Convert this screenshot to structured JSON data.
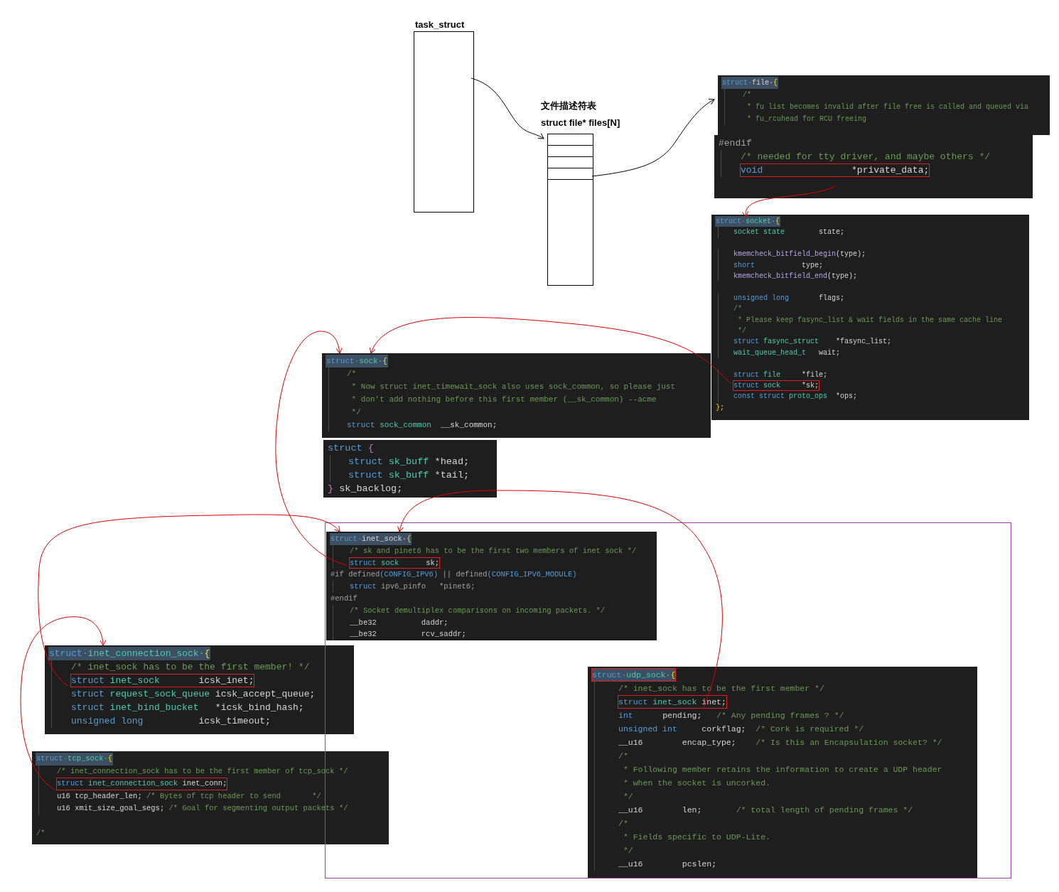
{
  "task_struct": {
    "title": "task_struct"
  },
  "fd_table": {
    "title": "文件描述符表",
    "subtitle": "struct file* files[N]"
  },
  "panels": [
    {
      "lines": [
        {
          "kind": "header",
          "indented": false,
          "boxed": false,
          "parts": [
            {
              "text": "struct·",
              "kind": "kw"
            },
            {
              "text": "file·",
              "kind": "id"
            },
            {
              "text": "{",
              "kind": "brace"
            }
          ]
        },
        {
          "kind": "code",
          "indented": true,
          "boxed": false,
          "parts": [
            {
              "text": "/*",
              "kind": "comment"
            }
          ]
        },
        {
          "kind": "code",
          "indented": true,
          "boxed": false,
          "parts": [
            {
              "text": " * fu list becomes invalid after file free is called and queued via",
              "kind": "comment"
            }
          ]
        },
        {
          "kind": "code",
          "indented": true,
          "boxed": false,
          "parts": [
            {
              "text": " * fu_rcuhead for RCU freeing",
              "kind": "comment"
            }
          ]
        }
      ]
    },
    {
      "lines": [
        {
          "kind": "code",
          "indented": false,
          "boxed": false,
          "parts": [
            {
              "text": "#endif",
              "kind": "preproc"
            }
          ]
        },
        {
          "kind": "code",
          "indented": true,
          "boxed": false,
          "parts": [
            {
              "text": "/* needed for tty driver, and maybe others */",
              "kind": "comment"
            }
          ]
        },
        {
          "kind": "code",
          "indented": true,
          "boxed": true,
          "parts": [
            {
              "text": "void",
              "kind": "kw"
            },
            {
              "text": "                *private_data;",
              "kind": "id"
            }
          ]
        }
      ]
    },
    {
      "lines": [
        {
          "kind": "header",
          "indented": false,
          "boxed": false,
          "parts": [
            {
              "text": "struct·",
              "kind": "kw"
            },
            {
              "text": "socket·",
              "kind": "type"
            },
            {
              "text": "{",
              "kind": "brace"
            }
          ]
        },
        {
          "kind": "code",
          "indented": true,
          "boxed": false,
          "parts": [
            {
              "text": "socket state",
              "kind": "type"
            },
            {
              "text": "        state;",
              "kind": "id"
            }
          ]
        },
        {
          "kind": "blank"
        },
        {
          "kind": "code",
          "indented": true,
          "boxed": false,
          "parts": [
            {
              "text": "kmemcheck_bitfield_begin",
              "kind": "fn"
            },
            {
              "text": "(type);",
              "kind": "id"
            }
          ]
        },
        {
          "kind": "code",
          "indented": true,
          "boxed": false,
          "parts": [
            {
              "text": "short",
              "kind": "kw"
            },
            {
              "text": "           type;",
              "kind": "id"
            }
          ]
        },
        {
          "kind": "code",
          "indented": true,
          "boxed": false,
          "parts": [
            {
              "text": "kmemcheck_bitfield_end",
              "kind": "fn"
            },
            {
              "text": "(type);",
              "kind": "id"
            }
          ]
        },
        {
          "kind": "blank"
        },
        {
          "kind": "code",
          "indented": true,
          "boxed": false,
          "parts": [
            {
              "text": "unsigned long",
              "kind": "kw"
            },
            {
              "text": "       flags;",
              "kind": "id"
            }
          ]
        },
        {
          "kind": "code",
          "indented": true,
          "boxed": false,
          "parts": [
            {
              "text": "/*",
              "kind": "comment"
            }
          ]
        },
        {
          "kind": "code",
          "indented": true,
          "boxed": false,
          "parts": [
            {
              "text": " * Please keep fasync_list & wait fields in the same cache line",
              "kind": "comment"
            }
          ]
        },
        {
          "kind": "code",
          "indented": true,
          "boxed": false,
          "parts": [
            {
              "text": " */",
              "kind": "comment"
            }
          ]
        },
        {
          "kind": "code",
          "indented": true,
          "boxed": false,
          "parts": [
            {
              "text": "struct ",
              "kind": "kw"
            },
            {
              "text": "fasync_struct",
              "kind": "type"
            },
            {
              "text": "    *fasync_list;",
              "kind": "id"
            }
          ]
        },
        {
          "kind": "code",
          "indented": true,
          "boxed": false,
          "parts": [
            {
              "text": "wait_queue_head_t",
              "kind": "type"
            },
            {
              "text": "   wait;",
              "kind": "id"
            }
          ]
        },
        {
          "kind": "blank"
        },
        {
          "kind": "code",
          "indented": true,
          "boxed": false,
          "parts": [
            {
              "text": "struct ",
              "kind": "kw"
            },
            {
              "text": "file",
              "kind": "type"
            },
            {
              "text": "     *file;",
              "kind": "id"
            }
          ]
        },
        {
          "kind": "code",
          "indented": true,
          "boxed": true,
          "parts": [
            {
              "text": "struct ",
              "kind": "kw"
            },
            {
              "text": "sock",
              "kind": "type"
            },
            {
              "text": "     *sk;",
              "kind": "id"
            }
          ]
        },
        {
          "kind": "code",
          "indented": true,
          "boxed": false,
          "parts": [
            {
              "text": "const struct ",
              "kind": "kw"
            },
            {
              "text": "proto_ops",
              "kind": "type"
            },
            {
              "text": "  *ops;",
              "kind": "id"
            }
          ]
        },
        {
          "kind": "code",
          "indented": false,
          "boxed": false,
          "parts": [
            {
              "text": "};",
              "kind": "brace"
            }
          ]
        }
      ]
    },
    {
      "lines": [
        {
          "kind": "header",
          "indented": false,
          "boxed": false,
          "parts": [
            {
              "text": "struct·",
              "kind": "kw"
            },
            {
              "text": "sock·",
              "kind": "type"
            },
            {
              "text": "{",
              "kind": "brace"
            }
          ]
        },
        {
          "kind": "code",
          "indented": true,
          "boxed": false,
          "parts": [
            {
              "text": "/*",
              "kind": "comment"
            }
          ]
        },
        {
          "kind": "code",
          "indented": true,
          "boxed": false,
          "parts": [
            {
              "text": " * Now struct inet_timewait_sock also uses sock_common, so please just",
              "kind": "comment"
            }
          ]
        },
        {
          "kind": "code",
          "indented": true,
          "boxed": false,
          "parts": [
            {
              "text": " * don't add nothing before this first member (__sk_common) --acme",
              "kind": "comment"
            }
          ]
        },
        {
          "kind": "code",
          "indented": true,
          "boxed": false,
          "parts": [
            {
              "text": " */",
              "kind": "comment"
            }
          ]
        },
        {
          "kind": "code",
          "indented": true,
          "boxed": false,
          "parts": [
            {
              "text": "struct ",
              "kind": "kw"
            },
            {
              "text": "sock_common",
              "kind": "type"
            },
            {
              "text": "  __sk_common;",
              "kind": "id"
            }
          ]
        }
      ]
    },
    {
      "lines": [
        {
          "kind": "code",
          "indented": false,
          "boxed": false,
          "parts": [
            {
              "text": "struct ",
              "kind": "kw"
            },
            {
              "text": "{",
              "kind": "macro"
            }
          ]
        },
        {
          "kind": "code",
          "indented": true,
          "boxed": false,
          "parts": [
            {
              "text": "struct ",
              "kind": "kw"
            },
            {
              "text": "sk_buff ",
              "kind": "type"
            },
            {
              "text": "*head;",
              "kind": "id"
            }
          ]
        },
        {
          "kind": "code",
          "indented": true,
          "boxed": false,
          "parts": [
            {
              "text": "struct ",
              "kind": "kw"
            },
            {
              "text": "sk_buff ",
              "kind": "type"
            },
            {
              "text": "*tail;",
              "kind": "id"
            }
          ]
        },
        {
          "kind": "code",
          "indented": false,
          "boxed": false,
          "parts": [
            {
              "text": "}",
              "kind": "macro"
            },
            {
              "text": " sk_backlog;",
              "kind": "id"
            }
          ]
        }
      ]
    },
    {
      "lines": [
        {
          "kind": "header",
          "indented": false,
          "boxed": false,
          "parts": [
            {
              "text": "struct·",
              "kind": "kw"
            },
            {
              "text": "inet_sock·",
              "kind": "id"
            },
            {
              "text": "{",
              "kind": "brace"
            }
          ]
        },
        {
          "kind": "code",
          "indented": true,
          "boxed": false,
          "parts": [
            {
              "text": "/* sk and pinet6 has to be the first two members of inet sock */",
              "kind": "comment"
            }
          ]
        },
        {
          "kind": "code",
          "indented": true,
          "boxed": true,
          "parts": [
            {
              "text": "struct ",
              "kind": "kw"
            },
            {
              "text": "sock",
              "kind": "type"
            },
            {
              "text": "      sk;",
              "kind": "id"
            }
          ]
        },
        {
          "kind": "code",
          "indented": false,
          "boxed": false,
          "parts": [
            {
              "text": "#if defined",
              "kind": "preproc"
            },
            {
              "text": "(CONFIG_IPV6)",
              "kind": "kw"
            },
            {
              "text": " || defined",
              "kind": "preproc"
            },
            {
              "text": "(CONFIG_IPV6_MODULE)",
              "kind": "kw"
            }
          ]
        },
        {
          "kind": "code",
          "indented": true,
          "boxed": false,
          "parts": [
            {
              "text": "struct ",
              "kind": "kw"
            },
            {
              "text": "ipv6_pinfo   *pinet6;",
              "kind": "preproc"
            }
          ]
        },
        {
          "kind": "code",
          "indented": false,
          "boxed": false,
          "parts": [
            {
              "text": "#endif",
              "kind": "preproc"
            }
          ]
        },
        {
          "kind": "code",
          "indented": true,
          "boxed": false,
          "parts": [
            {
              "text": "/* Socket demultiplex comparisons on incoming packets. */",
              "kind": "comment"
            }
          ]
        },
        {
          "kind": "code",
          "indented": true,
          "boxed": false,
          "parts": [
            {
              "text": "__be32",
              "kind": "id"
            },
            {
              "text": "          daddr;",
              "kind": "id"
            }
          ]
        },
        {
          "kind": "code",
          "indented": true,
          "boxed": false,
          "parts": [
            {
              "text": "__be32",
              "kind": "id"
            },
            {
              "text": "          rcv_saddr;",
              "kind": "id"
            }
          ]
        }
      ]
    },
    {
      "lines": [
        {
          "kind": "header",
          "indented": false,
          "boxed": false,
          "parts": [
            {
              "text": "struct·",
              "kind": "kw"
            },
            {
              "text": "inet_connection_sock·",
              "kind": "type"
            },
            {
              "text": "{",
              "kind": "brace"
            }
          ]
        },
        {
          "kind": "code",
          "indented": true,
          "boxed": false,
          "parts": [
            {
              "text": "/* inet_sock has to be the first member! */",
              "kind": "comment"
            }
          ]
        },
        {
          "kind": "code",
          "indented": true,
          "boxed": true,
          "parts": [
            {
              "text": "struct ",
              "kind": "kw"
            },
            {
              "text": "inet_sock",
              "kind": "type"
            },
            {
              "text": "       icsk_inet;",
              "kind": "id"
            }
          ]
        },
        {
          "kind": "code",
          "indented": true,
          "boxed": false,
          "parts": [
            {
              "text": "struct ",
              "kind": "kw"
            },
            {
              "text": "request_sock_queue",
              "kind": "type"
            },
            {
              "text": " icsk_accept_queue;",
              "kind": "id"
            }
          ]
        },
        {
          "kind": "code",
          "indented": true,
          "boxed": false,
          "parts": [
            {
              "text": "struct ",
              "kind": "kw"
            },
            {
              "text": "inet_bind_bucket",
              "kind": "type"
            },
            {
              "text": "   *icsk_bind_hash;",
              "kind": "id"
            }
          ]
        },
        {
          "kind": "code",
          "indented": true,
          "boxed": false,
          "parts": [
            {
              "text": "unsigned long",
              "kind": "kw"
            },
            {
              "text": "          icsk_timeout;",
              "kind": "id"
            }
          ]
        }
      ]
    },
    {
      "lines": [
        {
          "kind": "header",
          "indented": false,
          "boxed": false,
          "parts": [
            {
              "text": "struct·",
              "kind": "kw"
            },
            {
              "text": "tcp_sock·",
              "kind": "type"
            },
            {
              "text": "{",
              "kind": "brace"
            }
          ]
        },
        {
          "kind": "code",
          "indented": true,
          "boxed": false,
          "parts": [
            {
              "text": "/* inet_connection_sock has to be the first member of tcp_sock */",
              "kind": "comment"
            }
          ]
        },
        {
          "kind": "code",
          "indented": true,
          "boxed": true,
          "parts": [
            {
              "text": "struct ",
              "kind": "kw"
            },
            {
              "text": "inet_connection_sock",
              "kind": "type"
            },
            {
              "text": " inet_conn;",
              "kind": "id"
            }
          ]
        },
        {
          "kind": "code",
          "indented": true,
          "boxed": false,
          "parts": [
            {
              "text": "u16 tcp_header_len; ",
              "kind": "id"
            },
            {
              "text": "/* Bytes of tcp header to send       */",
              "kind": "comment"
            }
          ]
        },
        {
          "kind": "code",
          "indented": true,
          "boxed": false,
          "parts": [
            {
              "text": "u16 xmit_size_goal_segs; ",
              "kind": "id"
            },
            {
              "text": "/* Goal for segmenting output packets */",
              "kind": "comment"
            }
          ]
        },
        {
          "kind": "blank"
        },
        {
          "kind": "code",
          "indented": false,
          "boxed": false,
          "parts": [
            {
              "text": "/*",
              "kind": "comment"
            }
          ]
        }
      ]
    },
    {
      "lines": [
        {
          "kind": "header",
          "indented": false,
          "boxed": true,
          "parts": [
            {
              "text": "struct·",
              "kind": "kw"
            },
            {
              "text": "udp_sock·",
              "kind": "type"
            },
            {
              "text": "{",
              "kind": "brace"
            }
          ]
        },
        {
          "kind": "code",
          "indented": true,
          "boxed": false,
          "parts": [
            {
              "text": "/* inet_sock has to be the first member */",
              "kind": "comment"
            }
          ]
        },
        {
          "kind": "code",
          "indented": true,
          "boxed": true,
          "parts": [
            {
              "text": "struct ",
              "kind": "kw"
            },
            {
              "text": "inet_sock ",
              "kind": "type"
            },
            {
              "text": "inet;",
              "kind": "id"
            }
          ]
        },
        {
          "kind": "code",
          "indented": true,
          "boxed": false,
          "parts": [
            {
              "text": "int",
              "kind": "kw"
            },
            {
              "text": "      pending;",
              "kind": "id"
            },
            {
              "text": "   /* Any pending frames ? */",
              "kind": "comment"
            }
          ]
        },
        {
          "kind": "code",
          "indented": true,
          "boxed": false,
          "parts": [
            {
              "text": "unsigned int",
              "kind": "kw"
            },
            {
              "text": "     corkflag;",
              "kind": "id"
            },
            {
              "text": "  /* Cork is required */",
              "kind": "comment"
            }
          ]
        },
        {
          "kind": "code",
          "indented": true,
          "boxed": false,
          "parts": [
            {
              "text": "__u16",
              "kind": "id"
            },
            {
              "text": "        encap_type;",
              "kind": "id"
            },
            {
              "text": "    /* Is this an Encapsulation socket? */",
              "kind": "comment"
            }
          ]
        },
        {
          "kind": "code",
          "indented": true,
          "boxed": false,
          "parts": [
            {
              "text": "/*",
              "kind": "comment"
            }
          ]
        },
        {
          "kind": "code",
          "indented": true,
          "boxed": false,
          "parts": [
            {
              "text": " * Following member retains the information to create a UDP header",
              "kind": "comment"
            }
          ]
        },
        {
          "kind": "code",
          "indented": true,
          "boxed": false,
          "parts": [
            {
              "text": " * when the socket is uncorked.",
              "kind": "comment"
            }
          ]
        },
        {
          "kind": "code",
          "indented": true,
          "boxed": false,
          "parts": [
            {
              "text": " */",
              "kind": "comment"
            }
          ]
        },
        {
          "kind": "code",
          "indented": true,
          "boxed": false,
          "parts": [
            {
              "text": "__u16",
              "kind": "id"
            },
            {
              "text": "        len;",
              "kind": "id"
            },
            {
              "text": "       /* total length of pending frames */",
              "kind": "comment"
            }
          ]
        },
        {
          "kind": "code",
          "indented": true,
          "boxed": false,
          "parts": [
            {
              "text": "/*",
              "kind": "comment"
            }
          ]
        },
        {
          "kind": "code",
          "indented": true,
          "boxed": false,
          "parts": [
            {
              "text": " * Fields specific to UDP-Lite.",
              "kind": "comment"
            }
          ]
        },
        {
          "kind": "code",
          "indented": true,
          "boxed": false,
          "parts": [
            {
              "text": " */",
              "kind": "comment"
            }
          ]
        },
        {
          "kind": "code",
          "indented": true,
          "boxed": false,
          "parts": [
            {
              "text": "__u16",
              "kind": "id"
            },
            {
              "text": "        pcslen;",
              "kind": "id"
            }
          ]
        }
      ]
    }
  ]
}
